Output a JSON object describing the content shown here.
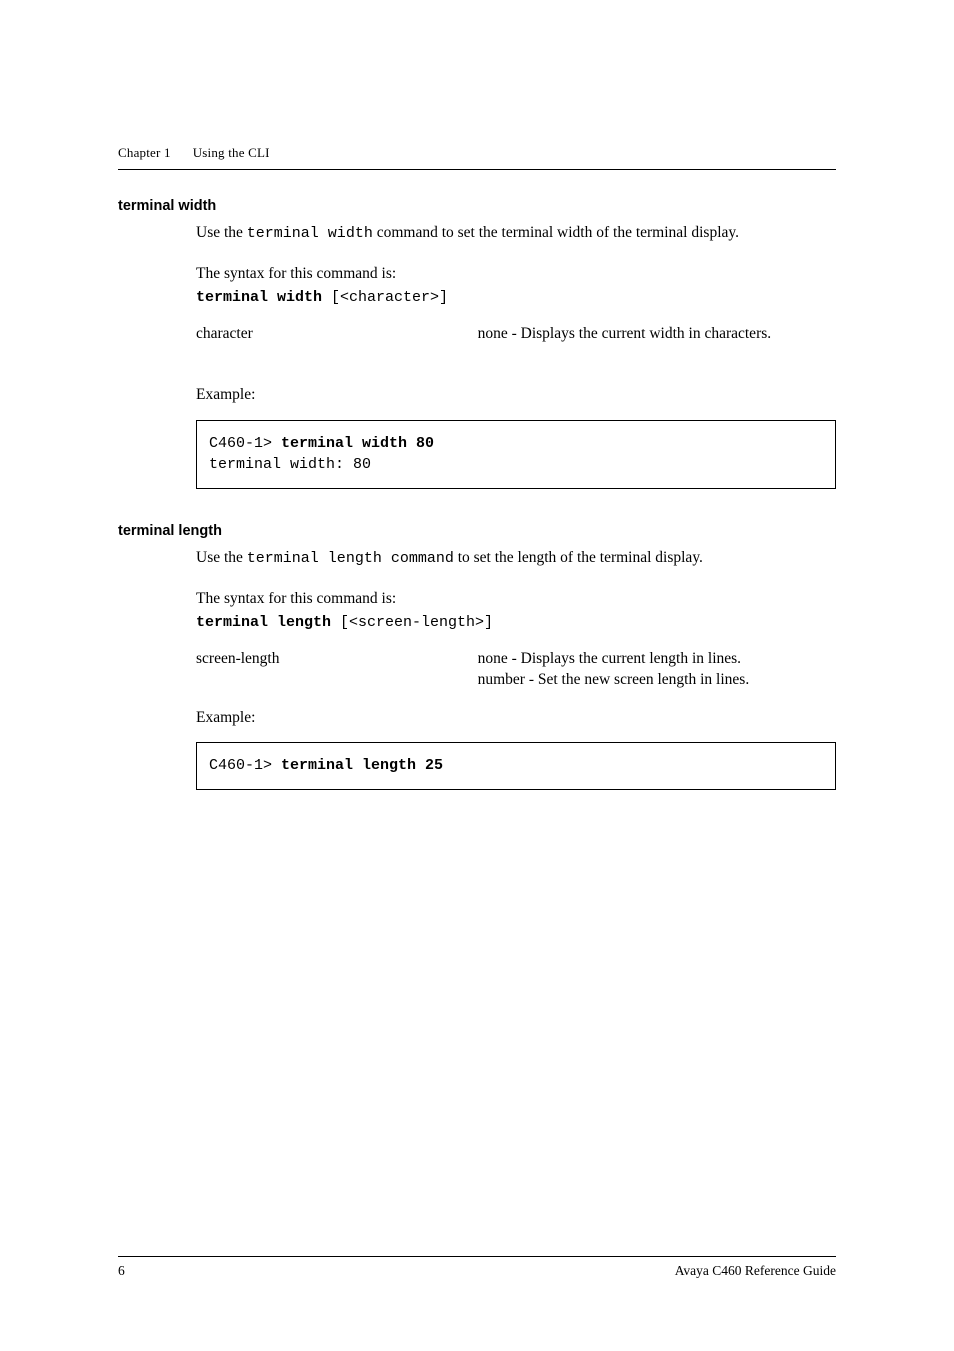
{
  "header": {
    "chapter": "Chapter 1",
    "title": "Using the CLI"
  },
  "sections": {
    "tw": {
      "heading": "terminal width",
      "intro_pre": "Use the ",
      "intro_cmd": "terminal width",
      "intro_post": " command to set the terminal width  of the terminal display.",
      "syntax_intro": "The syntax for this command is:",
      "syntax_bold": "terminal width",
      "syntax_rest": " [<character>]",
      "param_name": "character",
      "param_desc": "none - Displays the current width in characters.",
      "example_label": "Example:",
      "code_prompt": "C460-1> ",
      "code_cmd": "terminal width 80",
      "code_out": "terminal width: 80"
    },
    "tl": {
      "heading": "terminal length",
      "intro_pre": "Use the ",
      "intro_cmd": "terminal length command",
      "intro_post": " to set the length of the terminal display.",
      "syntax_intro": "The syntax for this command is:",
      "syntax_bold": "terminal length",
      "syntax_rest": " [<screen-length>]",
      "param_name": "screen-length",
      "param_desc1": "none - Displays the current length in lines.",
      "param_desc2": "number - Set the new screen length in lines.",
      "example_label": "Example:",
      "code_prompt": "C460-1> ",
      "code_cmd": "terminal length 25"
    }
  },
  "footer": {
    "page": "6",
    "doc": "Avaya C460 Reference Guide"
  }
}
